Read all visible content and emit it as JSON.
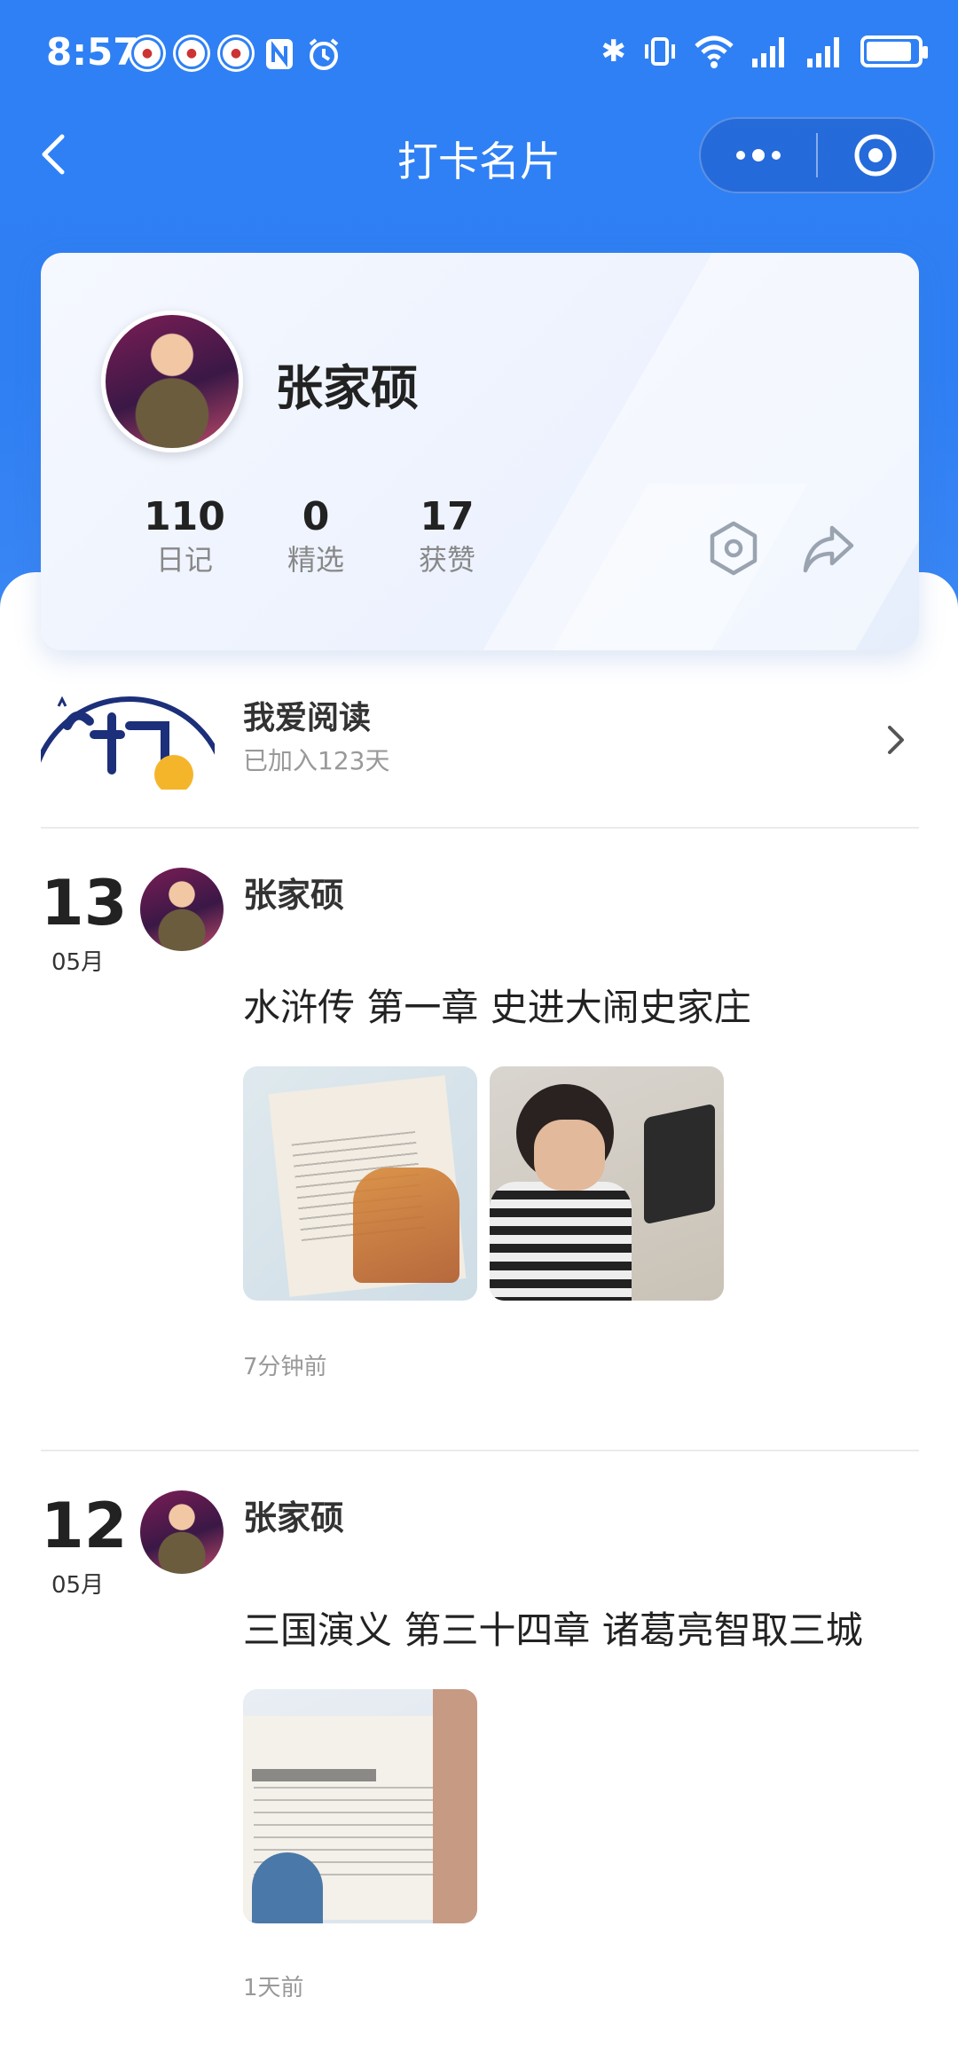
{
  "status_bar": {
    "time": "8:57",
    "battery_level": 0.9
  },
  "nav": {
    "title": "打卡名片"
  },
  "profile": {
    "name": "张家硕",
    "stats": [
      {
        "value": "110",
        "label": "日记"
      },
      {
        "value": "0",
        "label": "精选"
      },
      {
        "value": "17",
        "label": "获赞"
      }
    ]
  },
  "group": {
    "name": "我爱阅读",
    "joined": "已加入123天"
  },
  "posts": [
    {
      "day": "13",
      "month": "05月",
      "author": "张家硕",
      "text": "水浒传 第一章 史进大闹史家庄",
      "time": "7分钟前"
    },
    {
      "day": "12",
      "month": "05月",
      "author": "张家硕",
      "text": "三国演义 第三十四章 诸葛亮智取三城",
      "time": "1天前"
    }
  ],
  "colors": {
    "primary_blue": "#2f80f4",
    "text_dark": "#222222",
    "text_muted": "#999999"
  }
}
